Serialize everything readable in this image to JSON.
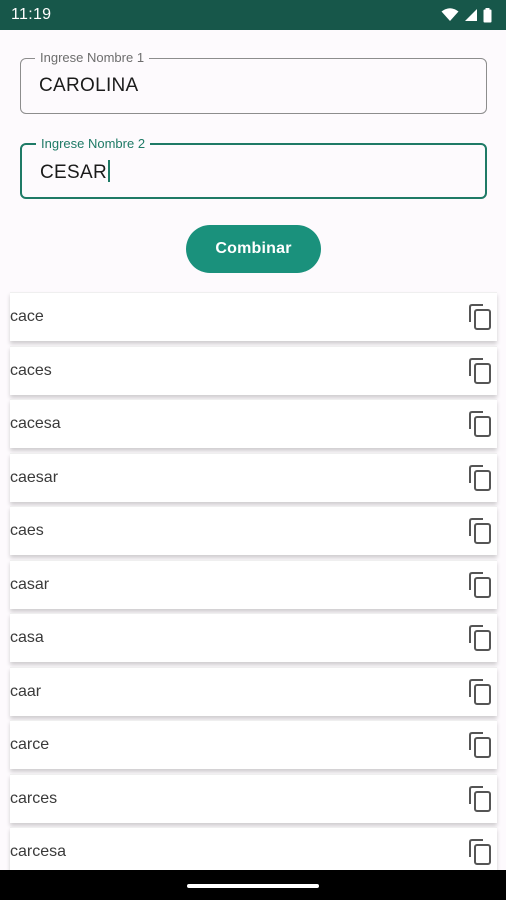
{
  "status_bar": {
    "time": "11:19",
    "icons": [
      "wifi-icon",
      "signal-icon",
      "battery-icon"
    ],
    "color": "#17574a"
  },
  "form": {
    "name1": {
      "label": "Ingrese Nombre 1",
      "value": "CAROLINA"
    },
    "name2": {
      "label": "Ingrese Nombre 2",
      "value": "CESAR"
    },
    "combine_label": "Combinar",
    "accent": "#1a917c"
  },
  "results": [
    {
      "word": "cace",
      "icon": "copy-icon"
    },
    {
      "word": "caces",
      "icon": "copy-icon"
    },
    {
      "word": "cacesa",
      "icon": "copy-icon"
    },
    {
      "word": "caesar",
      "icon": "copy-icon"
    },
    {
      "word": "caes",
      "icon": "copy-icon"
    },
    {
      "word": "casar",
      "icon": "copy-icon"
    },
    {
      "word": "casa",
      "icon": "copy-icon"
    },
    {
      "word": "caar",
      "icon": "copy-icon"
    },
    {
      "word": "carce",
      "icon": "copy-icon"
    },
    {
      "word": "carces",
      "icon": "copy-icon"
    },
    {
      "word": "carcesa",
      "icon": "copy-icon"
    }
  ]
}
